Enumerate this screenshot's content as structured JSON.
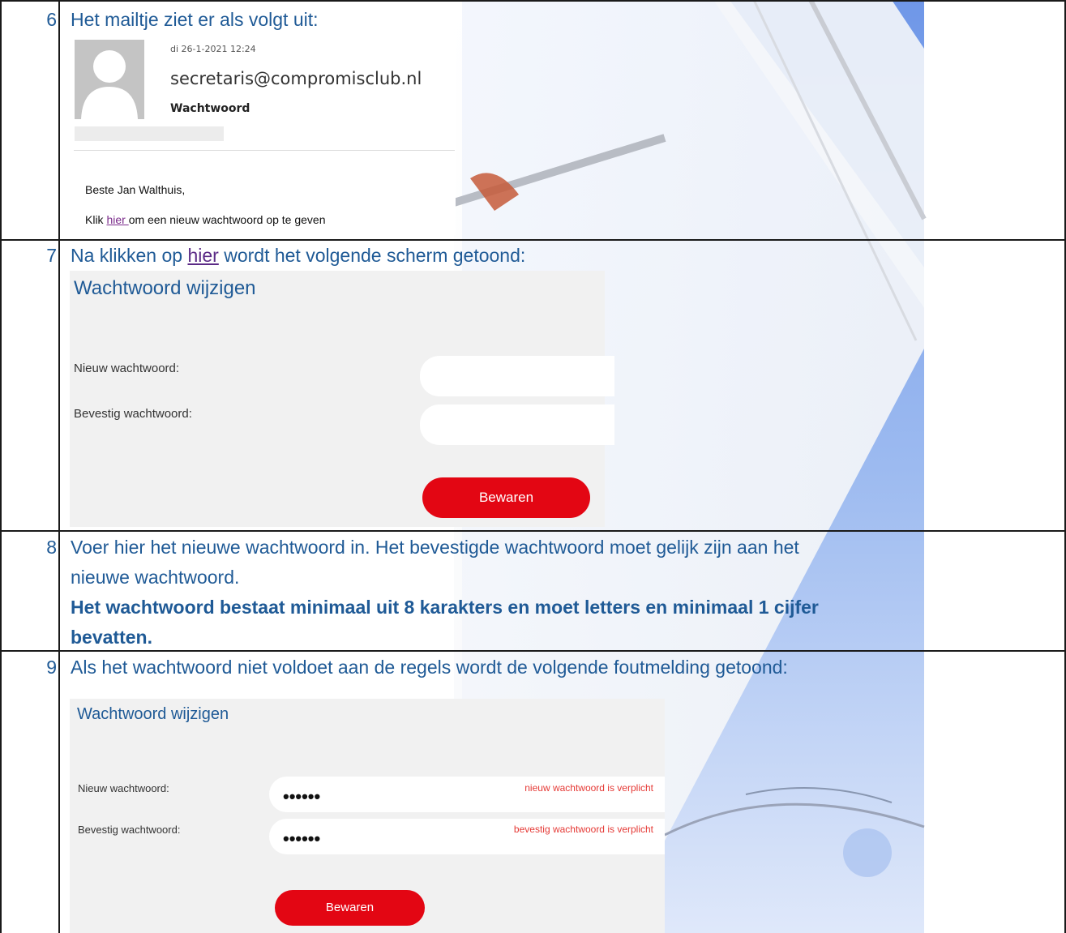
{
  "steps": [
    {
      "number": "6",
      "text": "Het mailtje ziet er als volgt uit:"
    },
    {
      "number": "7",
      "text_before": "Na klikken op ",
      "link": "hier",
      "text_after": " wordt het volgende scherm getoond:"
    },
    {
      "number": "8",
      "line1": "Voer hier het nieuwe wachtwoord in. Het bevestigde wachtwoord moet gelijk zijn aan het",
      "line2": "nieuwe wachtwoord.",
      "bold1": "Het wachtwoord bestaat minimaal uit 8 karakters en moet letters en minimaal 1 cijfer",
      "bold2": "bevatten."
    },
    {
      "number": "9",
      "text": "Als het wachtwoord niet voldoet aan de regels wordt de volgende foutmelding getoond:"
    }
  ],
  "email": {
    "date": "di 26-1-2021 12:24",
    "from": "secretaris@compromisclub.nl",
    "subject": "Wachtwoord",
    "greeting": "Beste Jan Walthuis,",
    "body_before": "Klik ",
    "body_link": "hier ",
    "body_after": "om een nieuw wachtwoord op te geven"
  },
  "form1": {
    "title": "Wachtwoord wijzigen",
    "new_label": "Nieuw wachtwoord:",
    "confirm_label": "Bevestig wachtwoord:",
    "button": "Bewaren"
  },
  "form2": {
    "title": "Wachtwoord wijzigen",
    "new_label": "Nieuw wachtwoord:",
    "confirm_label": "Bevestig wachtwoord:",
    "new_value": "••••••",
    "confirm_value": "••••••",
    "new_error": "nieuw wachtwoord is verplicht",
    "confirm_error": "bevestig wachtwoord is verplicht",
    "button": "Bewaren"
  },
  "colors": {
    "text_blue": "#1f5a96",
    "button_red": "#e30613",
    "error_red": "#e53935",
    "panel_grey": "#f1f1f1"
  }
}
